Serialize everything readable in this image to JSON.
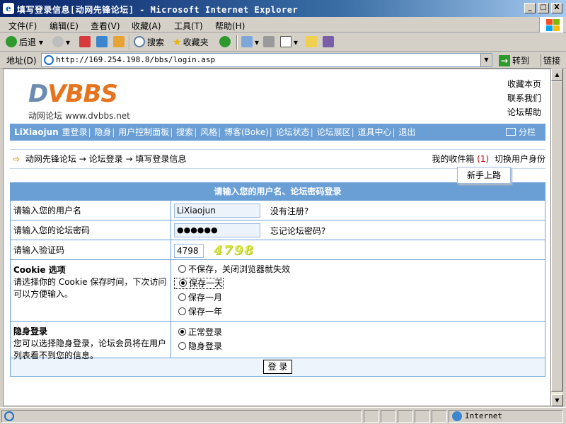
{
  "window": {
    "title": "填写登录信息[动网先锋论坛] - Microsoft Internet Explorer",
    "buttons": {
      "minimize": "_",
      "maximize": "□",
      "close": "X"
    }
  },
  "menu": [
    "文件(F)",
    "编辑(E)",
    "查看(V)",
    "收藏(A)",
    "工具(T)",
    "帮助(H)"
  ],
  "toolbar": {
    "back": "后退",
    "search": "搜索",
    "favorites": "收藏夹"
  },
  "address": {
    "label": "地址(D)",
    "url": "http://169.254.198.8/bbs/login.asp",
    "go": "转到",
    "links": "链接"
  },
  "site": {
    "logo_text": "DVBBS",
    "logo_sub": "动网论坛",
    "logo_site": "www.dvbbs.net",
    "toplinks": [
      "收藏本页",
      "联系我们",
      "论坛帮助"
    ]
  },
  "nav": {
    "user": "LiXiaojun",
    "items": [
      "重登录",
      "隐身",
      "用户控制面板",
      "搜索",
      "风格",
      "博客(Boke)",
      "论坛状态",
      "论坛展区",
      "道具中心",
      "退出"
    ],
    "column": "分栏"
  },
  "breadcrumb": {
    "items": [
      "动网先锋论坛",
      "论坛登录",
      "填写登录信息"
    ],
    "separator": "→",
    "inbox": "我的收件箱",
    "inbox_count": "(1)",
    "switch_user": "切换用户身份",
    "dropdown": "新手上路"
  },
  "form": {
    "header": "请输入您的用户名、论坛密码登录",
    "username_label": "请输入您的用户名",
    "username_value": "LiXiaojun",
    "register": "没有注册?",
    "password_label": "请输入您的论坛密码",
    "password_value": "●●●●●●",
    "forgot": "忘记论坛密码?",
    "captcha_label": "请输入验证码",
    "captcha_value": "4798",
    "captcha_image": "4798",
    "cookie_title": "Cookie 选项",
    "cookie_desc": "请选择你的 Cookie 保存时间，下次访问可以方便输入。",
    "cookie_options": [
      "不保存，关闭浏览器就失效",
      "保存一天",
      "保存一月",
      "保存一年"
    ],
    "cookie_selected": 1,
    "hidden_title": "隐身登录",
    "hidden_desc": "您可以选择隐身登录，论坛会员将在用户列表看不到您的信息。",
    "hidden_options": [
      "正常登录",
      "隐身登录"
    ],
    "hidden_selected": 0,
    "submit": "登 录"
  },
  "status": {
    "zone": "Internet"
  }
}
